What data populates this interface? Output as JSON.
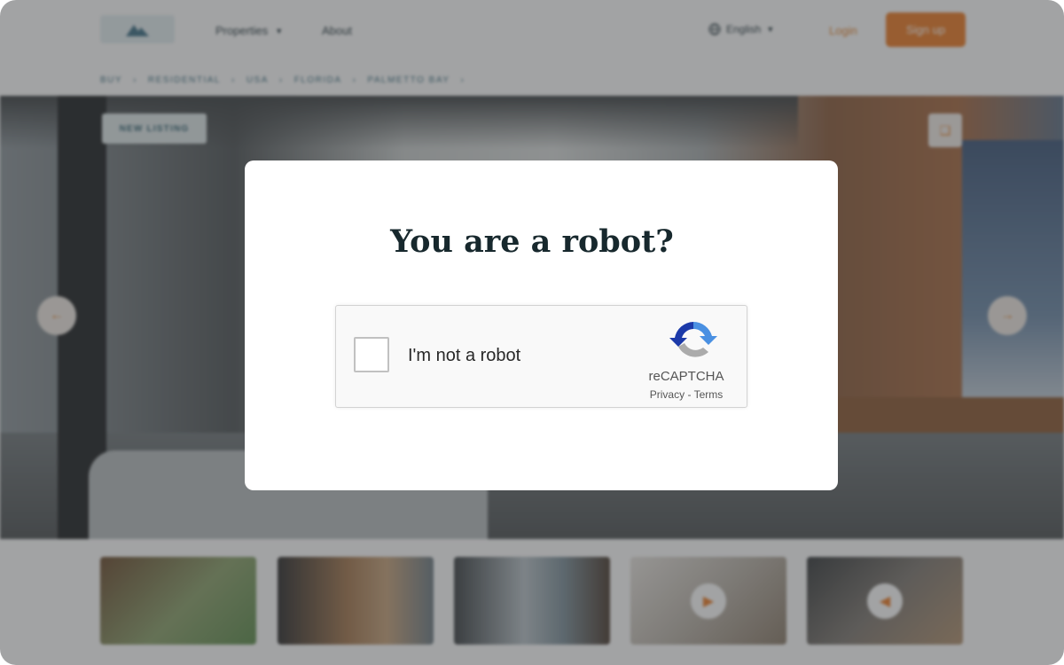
{
  "header": {
    "nav_properties": "Properties",
    "nav_about": "About",
    "language": "English",
    "login": "Login",
    "signup": "Sign up"
  },
  "breadcrumb": [
    "BUY",
    "RESIDENTIAL",
    "USA",
    "FLORIDA",
    "PALMETTO BAY"
  ],
  "listing": {
    "badge": "NEW LISTING"
  },
  "modal": {
    "title": "You are a robot?",
    "recaptcha": {
      "label": "I'm not a robot",
      "brand": "reCAPTCHA",
      "privacy": "Privacy",
      "separator": " - ",
      "terms": "Terms",
      "checked": false
    }
  },
  "icons": {
    "logo": "logo-mountain-icon",
    "globe": "globe-icon",
    "dropdown": "chevron-down-icon",
    "favorite": "bookmark-icon",
    "prev": "arrow-left-icon",
    "next": "arrow-right-icon",
    "play": "play-icon",
    "recaptcha": "recaptcha-logo-icon"
  },
  "colors": {
    "accent": "#ec7a23",
    "title": "#17282d",
    "overlay": "rgba(60,62,64,0.48)"
  }
}
